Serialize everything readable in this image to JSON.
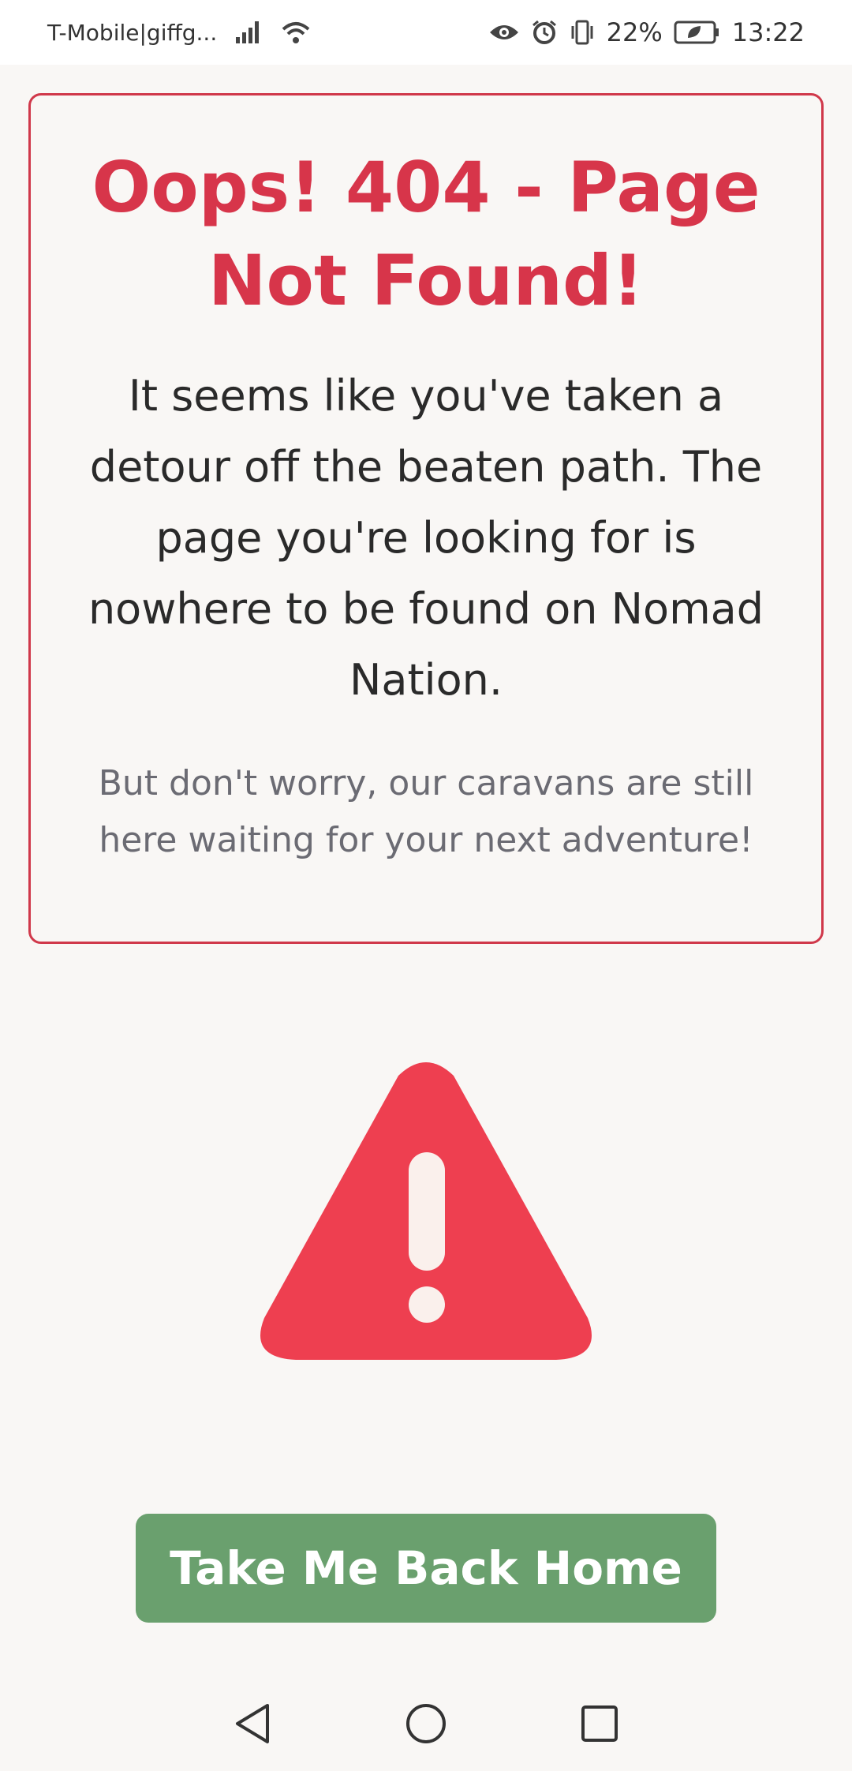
{
  "status_bar": {
    "carrier": "T-Mobile|giffg...",
    "battery": "22%",
    "time": "13:22",
    "icons": [
      "signal-icon",
      "wifi-icon",
      "eye-icon",
      "alarm-icon",
      "vibrate-icon",
      "battery-icon"
    ]
  },
  "error_card": {
    "title": "Oops! 404 - Page Not Found!",
    "message": "It seems like you've taken a detour off the beaten path. The page you're looking for is nowhere to be found on Nomad Nation.",
    "subtext": "But don't worry, our caravans are still here waiting for your next adventure!"
  },
  "warning_icon": "warning-triangle-icon",
  "home_button": {
    "label": "Take Me Back Home"
  },
  "nav_bar": {
    "icons": [
      "back-icon",
      "home-icon",
      "recents-icon"
    ]
  },
  "colors": {
    "accent_red": "#d7354a",
    "warning_red": "#ee3f50",
    "button_green": "#6aa06e",
    "background": "#f9f7f5"
  }
}
